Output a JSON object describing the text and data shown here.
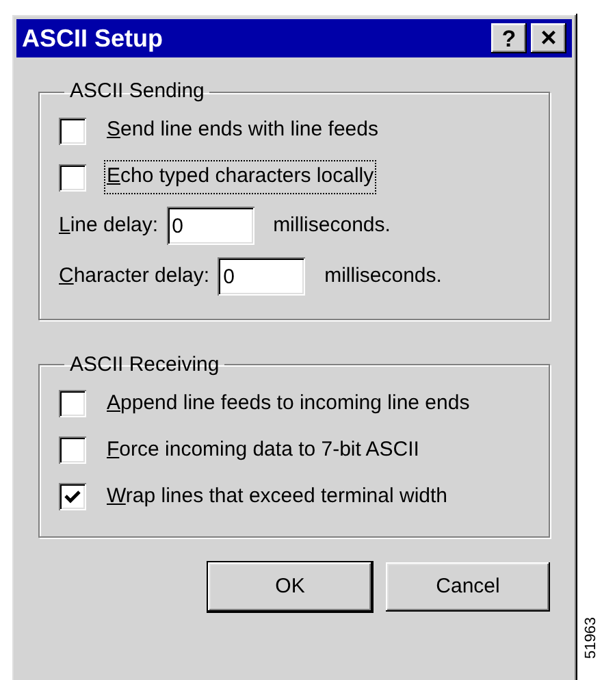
{
  "window": {
    "title": "ASCII Setup",
    "help_button": "?",
    "close_button": "×"
  },
  "groups": [
    {
      "title": "ASCII Sending",
      "items": [
        {
          "kind": "checkbox",
          "checked": false,
          "focused": false,
          "label": {
            "key": "S",
            "after": "end line ends with line feeds"
          }
        },
        {
          "kind": "checkbox",
          "checked": false,
          "focused": true,
          "label": {
            "key": "E",
            "after": "cho typed characters locally"
          }
        },
        {
          "kind": "field",
          "label": {
            "key": "L",
            "after": "ine delay:"
          },
          "value": "0",
          "unit": "milliseconds."
        },
        {
          "kind": "field",
          "label": {
            "key": "C",
            "after": "haracter delay:"
          },
          "value": "0",
          "unit": "milliseconds."
        }
      ]
    },
    {
      "title": "ASCII Receiving",
      "items": [
        {
          "kind": "checkbox",
          "checked": false,
          "focused": false,
          "label": {
            "key": "A",
            "after": "ppend line feeds to incoming line ends"
          }
        },
        {
          "kind": "checkbox",
          "checked": false,
          "focused": false,
          "label": {
            "key": "F",
            "after": "orce incoming data to 7-bit ASCII"
          }
        },
        {
          "kind": "checkbox",
          "checked": true,
          "focused": false,
          "label": {
            "key": "W",
            "after": "rap lines that exceed terminal width"
          }
        }
      ]
    }
  ],
  "buttons": [
    {
      "label": "OK",
      "default": true
    },
    {
      "label": "Cancel",
      "default": false
    }
  ],
  "figure_number": "51963"
}
